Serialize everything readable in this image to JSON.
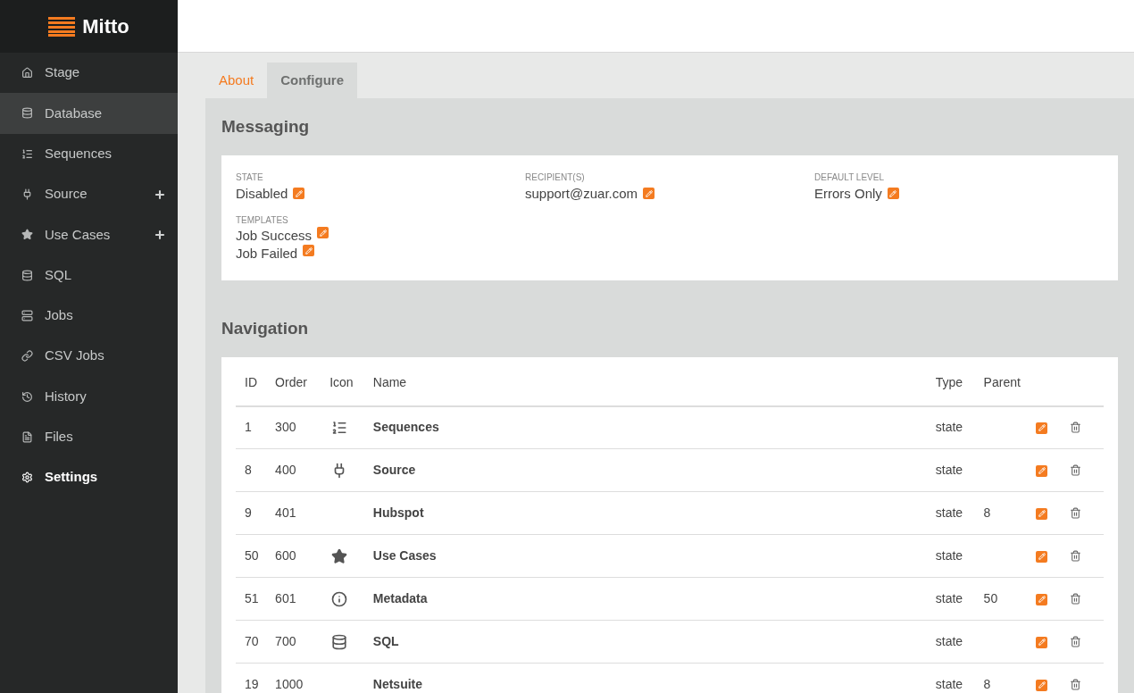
{
  "brand": {
    "name": "Mitto"
  },
  "sidebar": {
    "items": [
      {
        "label": "Stage",
        "kind": "home",
        "selected": false,
        "highlighted": false,
        "addable": false
      },
      {
        "label": "Database",
        "kind": "database",
        "selected": false,
        "highlighted": true,
        "addable": false
      },
      {
        "label": "Sequences",
        "kind": "list",
        "selected": false,
        "highlighted": false,
        "addable": false
      },
      {
        "label": "Source",
        "kind": "plug",
        "selected": false,
        "highlighted": false,
        "addable": true
      },
      {
        "label": "Use Cases",
        "kind": "star",
        "selected": false,
        "highlighted": false,
        "addable": true
      },
      {
        "label": "SQL",
        "kind": "database",
        "selected": false,
        "highlighted": false,
        "addable": false
      },
      {
        "label": "Jobs",
        "kind": "server",
        "selected": false,
        "highlighted": false,
        "addable": false
      },
      {
        "label": "CSV Jobs",
        "kind": "link",
        "selected": false,
        "highlighted": false,
        "addable": false
      },
      {
        "label": "History",
        "kind": "history",
        "selected": false,
        "highlighted": false,
        "addable": false
      },
      {
        "label": "Files",
        "kind": "file",
        "selected": false,
        "highlighted": false,
        "addable": false
      },
      {
        "label": "Settings",
        "kind": "gear",
        "selected": true,
        "highlighted": false,
        "addable": false
      }
    ]
  },
  "tabs": [
    {
      "label": "About",
      "selected": false
    },
    {
      "label": "Configure",
      "selected": true
    }
  ],
  "messaging": {
    "title": "Messaging",
    "fields": [
      {
        "label": "STATE",
        "value": "Disabled"
      },
      {
        "label": "RECIPIENT(S)",
        "value": "support@zuar.com"
      },
      {
        "label": "DEFAULT LEVEL",
        "value": "Errors Only"
      }
    ],
    "templates": {
      "label": "TEMPLATES",
      "items": [
        "Job Success",
        "Job Failed"
      ]
    }
  },
  "navigation": {
    "title": "Navigation",
    "columns": [
      "ID",
      "Order",
      "Icon",
      "Name",
      "Type",
      "Parent"
    ],
    "rows": [
      {
        "id": "1",
        "order": "300",
        "kind": "list",
        "name": "Sequences",
        "type": "state"
      },
      {
        "id": "8",
        "order": "400",
        "kind": "plug",
        "name": "Source",
        "type": "state"
      },
      {
        "id": "9",
        "order": "401",
        "kind": "plain",
        "name": "Hubspot",
        "type": "state",
        "parent": "8"
      },
      {
        "id": "50",
        "order": "600",
        "kind": "star",
        "name": "Use Cases",
        "type": "state"
      },
      {
        "id": "51",
        "order": "601",
        "kind": "info",
        "name": "Metadata",
        "type": "state",
        "parent": "50"
      },
      {
        "id": "70",
        "order": "700",
        "kind": "database",
        "name": "SQL",
        "type": "state"
      },
      {
        "id": "19",
        "order": "1000",
        "kind": "plain",
        "name": "Netsuite",
        "type": "state",
        "parent": "8"
      }
    ]
  }
}
